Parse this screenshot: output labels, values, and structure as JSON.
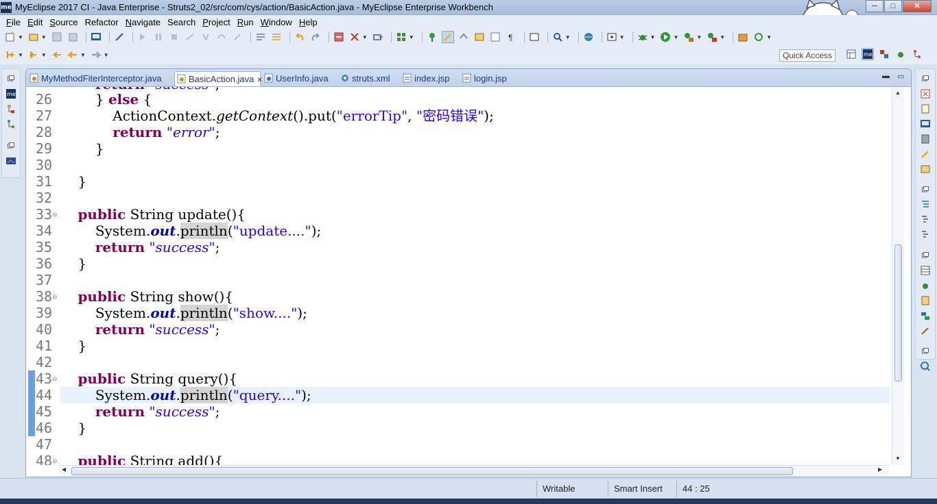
{
  "window": {
    "title": "MyEclipse 2017 CI - Java Enterprise - Struts2_02/src/com/cys/action/BasicAction.java - MyEclipse Enterprise Workbench",
    "app_icon_text": "me",
    "minimize": "─",
    "maximize": "□",
    "close": "✕"
  },
  "menu": [
    {
      "label": "File",
      "mnemonic": "F",
      "rest": "ile"
    },
    {
      "label": "Edit",
      "mnemonic": "E",
      "rest": "dit"
    },
    {
      "label": "Source",
      "mnemonic": "S",
      "rest": "ource"
    },
    {
      "label": "Refactor",
      "mnemonic": "",
      "rest": "Refactor"
    },
    {
      "label": "Navigate",
      "mnemonic": "N",
      "rest": "avigate"
    },
    {
      "label": "Search",
      "mnemonic": "",
      "rest": "Search"
    },
    {
      "label": "Project",
      "mnemonic": "P",
      "rest": "roject"
    },
    {
      "label": "Run",
      "mnemonic": "R",
      "rest": "un"
    },
    {
      "label": "Window",
      "mnemonic": "W",
      "rest": "indow"
    },
    {
      "label": "Help",
      "mnemonic": "H",
      "rest": "elp"
    }
  ],
  "quick_access": {
    "label": "Quick Access"
  },
  "tabs": [
    {
      "label": "MyMethodFiterInterceptor.java",
      "icon": "java-file-icon"
    },
    {
      "label": "BasicAction.java",
      "icon": "java-file-icon",
      "close": "✕"
    },
    {
      "label": "UserInfo.java",
      "icon": "java-file-icon"
    },
    {
      "label": "struts.xml",
      "icon": "xml-file-icon"
    },
    {
      "label": "index.jsp",
      "icon": "jsp-file-icon"
    },
    {
      "label": "login.jsp",
      "icon": "jsp-file-icon"
    }
  ],
  "editor": {
    "current_line": 44,
    "lines": [
      {
        "n": "26",
        "fold": false
      },
      {
        "n": "27",
        "fold": false
      },
      {
        "n": "28",
        "fold": false
      },
      {
        "n": "29",
        "fold": false
      },
      {
        "n": "30",
        "fold": false
      },
      {
        "n": "31",
        "fold": false
      },
      {
        "n": "32",
        "fold": false
      },
      {
        "n": "33",
        "fold": true
      },
      {
        "n": "34",
        "fold": false
      },
      {
        "n": "35",
        "fold": false
      },
      {
        "n": "36",
        "fold": false
      },
      {
        "n": "37",
        "fold": false
      },
      {
        "n": "38",
        "fold": true
      },
      {
        "n": "39",
        "fold": false
      },
      {
        "n": "40",
        "fold": false
      },
      {
        "n": "41",
        "fold": false
      },
      {
        "n": "42",
        "fold": false
      },
      {
        "n": "43",
        "fold": true
      },
      {
        "n": "44",
        "fold": false
      },
      {
        "n": "45",
        "fold": false
      },
      {
        "n": "46",
        "fold": false
      },
      {
        "n": "47",
        "fold": false
      },
      {
        "n": "48",
        "fold": true
      }
    ],
    "code": {
      "l25_partial": "return \"success\";",
      "l26_close": "} ",
      "l26_else": "else",
      "l26_brace": " {",
      "l27_obj": "ActionContext.",
      "l27_method": "getContext",
      "l27_mid": "().put(",
      "l27_s1": "\"errorTip\"",
      "l27_comma": ", ",
      "l27_s2": "\"密码错误\"",
      "l27_end": ");",
      "return_kw": "return",
      "l28_str": "\"error\"",
      "semi": ";",
      "close_brace": "}",
      "public_kw": "public",
      "string_type": " String ",
      "update_sig": "update(){",
      "show_sig": "show(){",
      "query_sig": "query(){",
      "add_sig": "add(){",
      "system": "System.",
      "out": "out",
      "dot": ".",
      "println": "println",
      "lparen": "(",
      "s_update": "\"update....\"",
      "s_show": "\"show....\"",
      "s_query": "\"query....\"",
      "rparen_semi": ");",
      "success": "\"success\""
    }
  },
  "status": {
    "writable": "Writable",
    "insert_mode": "Smart Insert",
    "position": "44 : 25"
  },
  "colors": {
    "keyword": "#7f0055",
    "string": "#2a00ff",
    "field": "#0000c0",
    "current_line": "#e8f2fe"
  }
}
